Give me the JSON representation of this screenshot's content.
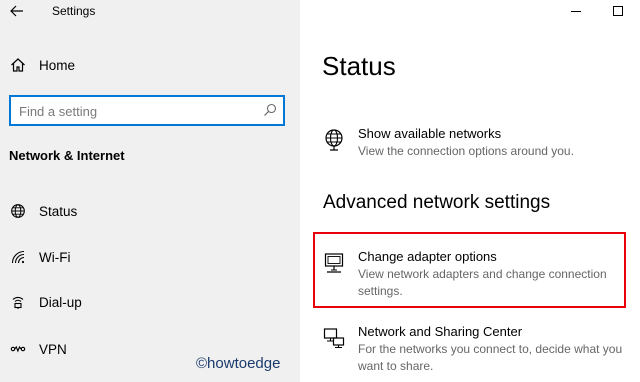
{
  "window": {
    "title": "Settings"
  },
  "sidebar": {
    "home_label": "Home",
    "search": {
      "placeholder": "Find a setting"
    },
    "section_title": "Network & Internet",
    "items": [
      {
        "label": "Status",
        "icon": "globe-icon"
      },
      {
        "label": "Wi-Fi",
        "icon": "wifi-icon"
      },
      {
        "label": "Dial-up",
        "icon": "dialup-icon"
      },
      {
        "label": "VPN",
        "icon": "vpn-icon"
      }
    ]
  },
  "main": {
    "page_title": "Status",
    "show_networks": {
      "title": "Show available networks",
      "description": "View the connection options around you.",
      "icon": "network-globe-icon"
    },
    "advanced_header": "Advanced network settings",
    "adapter_options": {
      "title": "Change adapter options",
      "description": "View network adapters and change connection settings.",
      "icon": "adapter-monitor-icon"
    },
    "sharing_center": {
      "title": "Network and Sharing Center",
      "description": "For the networks you connect to, decide what you want to share.",
      "icon": "sharing-center-icon"
    }
  },
  "watermark": "©howtoedge",
  "colors": {
    "accent": "#0078d7",
    "highlight": "#e8000b",
    "sidebar_bg": "#f0f0f0"
  }
}
